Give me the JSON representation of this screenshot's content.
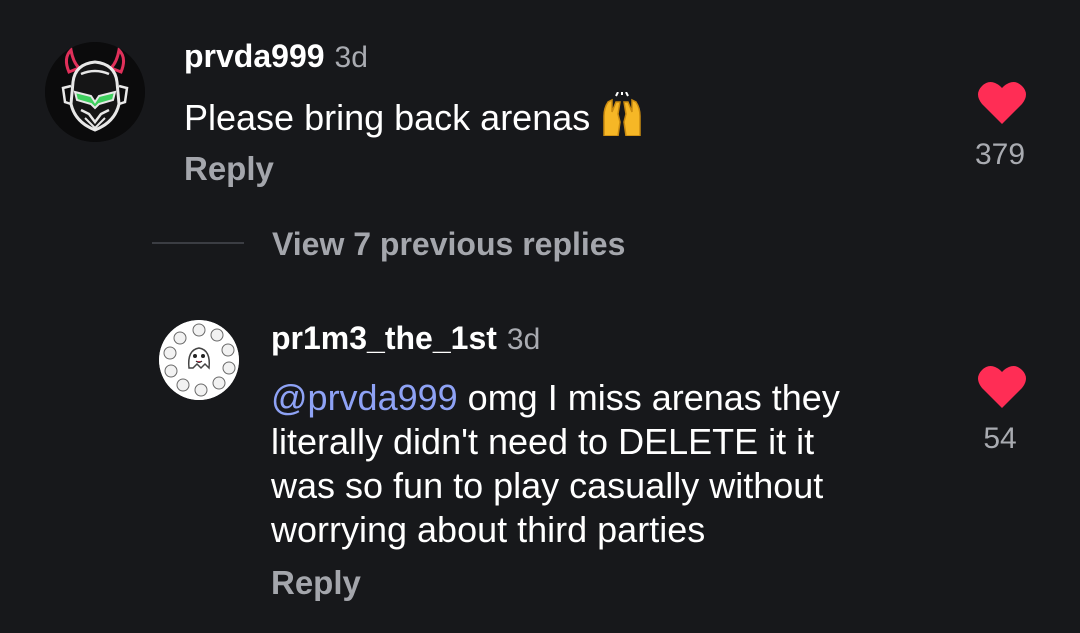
{
  "comments": [
    {
      "username": "prvda999",
      "time": "3d",
      "text": "Please bring back arenas",
      "emoji": "raising-hands-emoji",
      "reply_label": "Reply",
      "likes": "379"
    },
    {
      "username": "pr1m3_the_1st",
      "time": "3d",
      "mention": "@prvda999",
      "text_lines": [
        " omg I miss arenas they",
        "literally didn't need to DELETE it it",
        "was so fun to play casually without",
        "worrying about third parties"
      ],
      "reply_label": "Reply",
      "likes": "54"
    }
  ],
  "view_replies_label": "View 7 previous replies",
  "colors": {
    "background": "#17181b",
    "heart": "#ff2d55",
    "mention": "#8ea2f5",
    "muted_text": "#a4a6ac"
  },
  "icons": [
    "heart-icon",
    "raising-hands-emoji",
    "avatar-helmet",
    "avatar-ghost"
  ]
}
